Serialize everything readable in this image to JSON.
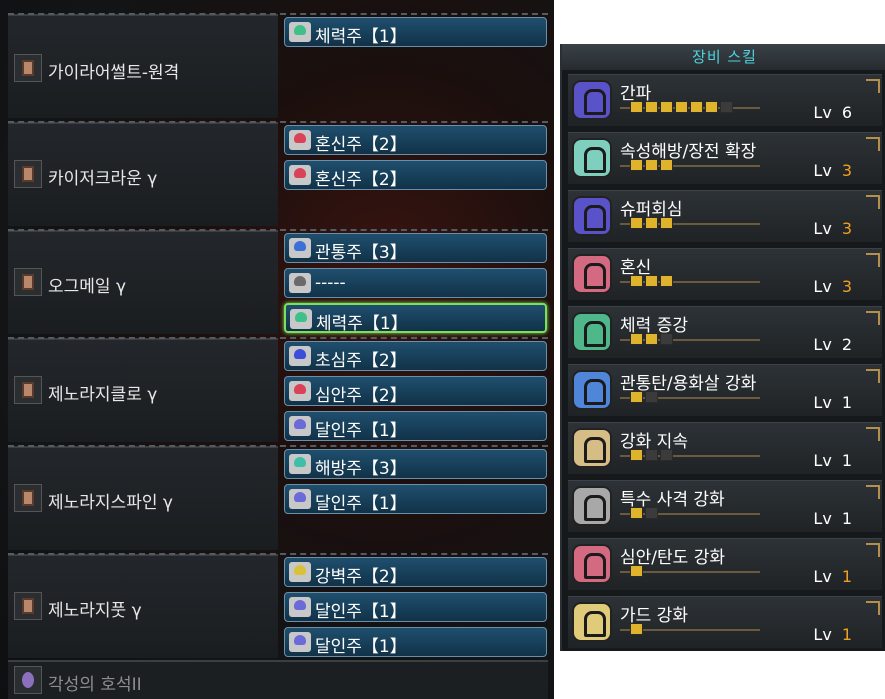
{
  "equipment": [
    {
      "name": "가이라어썰트-원격"
    },
    {
      "name": "카이저크라운 γ"
    },
    {
      "name": "오그메일 γ"
    },
    {
      "name": "제노라지클로 γ"
    },
    {
      "name": "제노라지스파인 γ"
    },
    {
      "name": "제노라지풋 γ"
    }
  ],
  "slots": [
    {
      "text": "체력주【1】",
      "gem": "#3fbf8a"
    },
    {
      "text": "혼신주【2】",
      "gem": "#d9435a"
    },
    {
      "text": "혼신주【2】",
      "gem": "#d9435a"
    },
    {
      "text": "관통주【3】",
      "gem": "#3c6fd8"
    },
    {
      "text": "-----",
      "gem": "#6a6a6a"
    },
    {
      "text": "체력주【1】",
      "gem": "#3fbf8a"
    },
    {
      "text": "초심주【2】",
      "gem": "#3c4fd8"
    },
    {
      "text": "심안주【2】",
      "gem": "#d9435a"
    },
    {
      "text": "달인주【1】",
      "gem": "#6a6ad8"
    },
    {
      "text": "해방주【3】",
      "gem": "#3fbfa8"
    },
    {
      "text": "달인주【1】",
      "gem": "#6a6ad8"
    },
    {
      "text": "강벽주【2】",
      "gem": "#d9c23a"
    },
    {
      "text": "달인주【1】",
      "gem": "#6a6ad8"
    },
    {
      "text": "달인주【1】",
      "gem": "#6a6ad8"
    }
  ],
  "awakening": {
    "name": "각성의 호석II"
  },
  "skills_panel": {
    "title": "장비 스킬",
    "skills": [
      {
        "name": "간파",
        "level": "6",
        "filled": 6,
        "max": 7,
        "gem": "#5a52c9",
        "level_color": "#ffffff"
      },
      {
        "name": "속성해방/장전 확장",
        "level": "3",
        "filled": 3,
        "max": 3,
        "gem": "#7fcfbf",
        "level_color": "#f0a020"
      },
      {
        "name": "슈퍼회심",
        "level": "3",
        "filled": 3,
        "max": 3,
        "gem": "#5a52c9",
        "level_color": "#f0a020"
      },
      {
        "name": "혼신",
        "level": "3",
        "filled": 3,
        "max": 3,
        "gem": "#d46a82",
        "level_color": "#f0a020"
      },
      {
        "name": "체력 증강",
        "level": "2",
        "filled": 2,
        "max": 3,
        "gem": "#4fb88a",
        "level_color": "#ffffff"
      },
      {
        "name": "관통탄/용화살 강화",
        "level": "1",
        "filled": 1,
        "max": 2,
        "gem": "#4f86d9",
        "level_color": "#ffffff"
      },
      {
        "name": "강화 지속",
        "level": "1",
        "filled": 1,
        "max": 3,
        "gem": "#d6bd86",
        "level_color": "#ffffff"
      },
      {
        "name": "특수 사격 강화",
        "level": "1",
        "filled": 1,
        "max": 2,
        "gem": "#a8a8a8",
        "level_color": "#ffffff"
      },
      {
        "name": "심안/탄도 강화",
        "level": "1",
        "filled": 1,
        "max": 1,
        "gem": "#d46a82",
        "level_color": "#f0a020"
      },
      {
        "name": "가드 강화",
        "level": "1",
        "filled": 1,
        "max": 1,
        "gem": "#e0cb7a",
        "level_color": "#f0a020"
      }
    ],
    "lv_label": "Lv"
  }
}
